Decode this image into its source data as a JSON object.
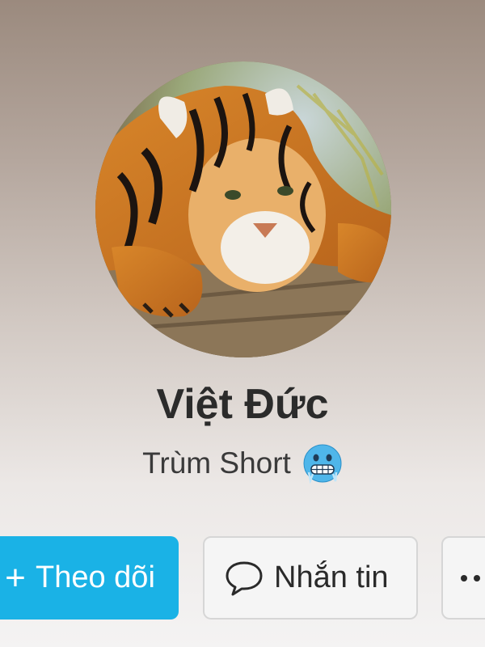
{
  "profile": {
    "display_name": "Việt Đức",
    "bio": "Trùm Short",
    "bio_emoji": "cold-face-emoji",
    "avatar": "tiger-avatar"
  },
  "actions": {
    "follow_icon": "+",
    "follow_label": "Theo dõi",
    "message_icon": "chat-bubble-icon",
    "message_label": "Nhắn tin",
    "more_icon": "more-dots-icon"
  },
  "colors": {
    "follow_button": "#1ab2e6",
    "secondary_button": "#f5f5f5",
    "name_text": "#2b2b2b"
  }
}
